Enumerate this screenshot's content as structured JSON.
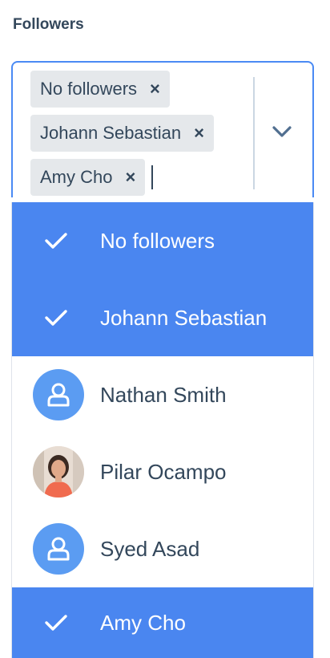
{
  "field_label": "Followers",
  "selected_tags": [
    {
      "label": "No followers",
      "remove": "×"
    },
    {
      "label": "Johann Sebastian",
      "remove": "×"
    },
    {
      "label": "Amy Cho",
      "remove": "×"
    }
  ],
  "options": [
    {
      "label": "No followers",
      "selected": true,
      "icon": "check-icon"
    },
    {
      "label": "Johann Sebastian",
      "selected": true,
      "icon": "check-icon"
    },
    {
      "label": "Nathan Smith",
      "selected": false,
      "icon": "user-avatar-icon"
    },
    {
      "label": "Pilar Ocampo",
      "selected": false,
      "icon": "photo-avatar"
    },
    {
      "label": "Syed Asad",
      "selected": false,
      "icon": "user-avatar-icon"
    },
    {
      "label": "Amy Cho",
      "selected": true,
      "icon": "check-icon"
    }
  ],
  "colors": {
    "accent": "#4a86f0",
    "text": "#33475b",
    "tag_bg": "#e5e8eb",
    "border_focus": "#4a8af4"
  }
}
